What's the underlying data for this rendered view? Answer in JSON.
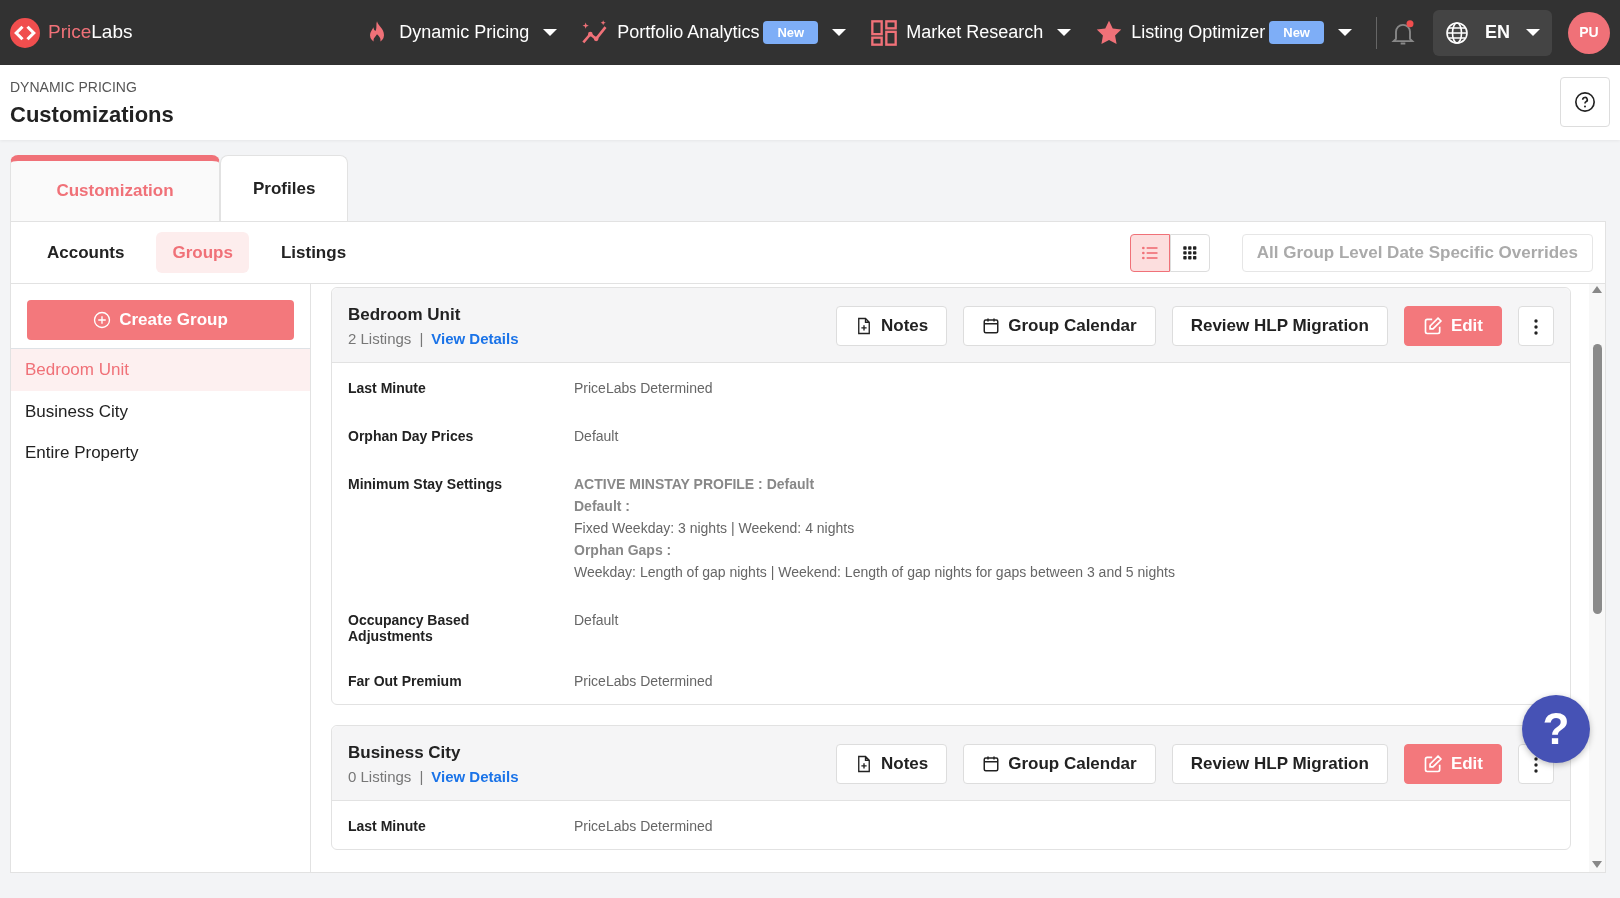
{
  "brand": {
    "first": "Price",
    "second": "Labs"
  },
  "nav": [
    {
      "label": "Dynamic Pricing"
    },
    {
      "label": "Portfolio Analytics",
      "badge": "New"
    },
    {
      "label": "Market Research"
    },
    {
      "label": "Listing Optimizer",
      "badge": "New"
    }
  ],
  "language": "EN",
  "avatar": "PU",
  "header": {
    "overline": "DYNAMIC PRICING",
    "title": "Customizations"
  },
  "tabs": [
    {
      "label": "Customization",
      "selected": true
    },
    {
      "label": "Profiles",
      "selected": false
    }
  ],
  "subtabs": [
    {
      "label": "Accounts",
      "selected": false
    },
    {
      "label": "Groups",
      "selected": true
    },
    {
      "label": "Listings",
      "selected": false
    }
  ],
  "view_toggle": [
    {
      "kind": "list",
      "selected": true
    },
    {
      "kind": "grid",
      "selected": false
    }
  ],
  "overrides_button": {
    "label": "All Group Level Date Specific Overrides",
    "disabled": true
  },
  "sidebar": {
    "create_button": "Create Group",
    "items": [
      {
        "label": "Bedroom Unit",
        "selected": true
      },
      {
        "label": "Business City",
        "selected": false
      },
      {
        "label": "Entire Property",
        "selected": false
      }
    ]
  },
  "groups": [
    {
      "name": "Bedroom Unit",
      "listings": "2 Listings",
      "separator": "|",
      "link": "View Details",
      "actions": [
        {
          "kind": "notes",
          "label": "Notes"
        },
        {
          "kind": "calendar",
          "label": "Group Calendar"
        },
        {
          "kind": "plain",
          "label": "Review HLP Migration"
        },
        {
          "kind": "edit",
          "label": "Edit"
        },
        {
          "kind": "more"
        }
      ],
      "rows": [
        {
          "label": "Last Minute",
          "lines": [
            {
              "text": "PriceLabs Determined",
              "bold": false
            }
          ]
        },
        {
          "label": "Orphan Day Prices",
          "lines": [
            {
              "text": "Default",
              "bold": false
            }
          ]
        },
        {
          "label": "Minimum Stay Settings",
          "lines": [
            {
              "text": "ACTIVE MINSTAY PROFILE : Default",
              "bold": true
            },
            {
              "text": "Default :",
              "bold": true
            },
            {
              "text": "Fixed Weekday: 3 nights | Weekend: 4 nights",
              "bold": false
            },
            {
              "text": "Orphan Gaps :",
              "bold": true
            },
            {
              "text": "Weekday: Length of gap nights | Weekend: Length of gap nights for gaps between 3 and 5 nights",
              "bold": false
            }
          ]
        },
        {
          "label": "Occupancy Based Adjustments",
          "lines": [
            {
              "text": "Default",
              "bold": false
            }
          ]
        },
        {
          "label": "Far Out Premium",
          "lines": [
            {
              "text": "PriceLabs Determined",
              "bold": false
            }
          ]
        }
      ]
    },
    {
      "name": "Business City",
      "listings": "0 Listings",
      "separator": "|",
      "link": "View Details",
      "actions": [
        {
          "kind": "notes",
          "label": "Notes"
        },
        {
          "kind": "calendar",
          "label": "Group Calendar"
        },
        {
          "kind": "plain",
          "label": "Review HLP Migration"
        },
        {
          "kind": "edit",
          "label": "Edit"
        },
        {
          "kind": "more"
        }
      ],
      "rows": [
        {
          "label": "Last Minute",
          "lines": [
            {
              "text": "PriceLabs Determined",
              "bold": false
            }
          ]
        }
      ]
    }
  ],
  "help_fab": "?"
}
